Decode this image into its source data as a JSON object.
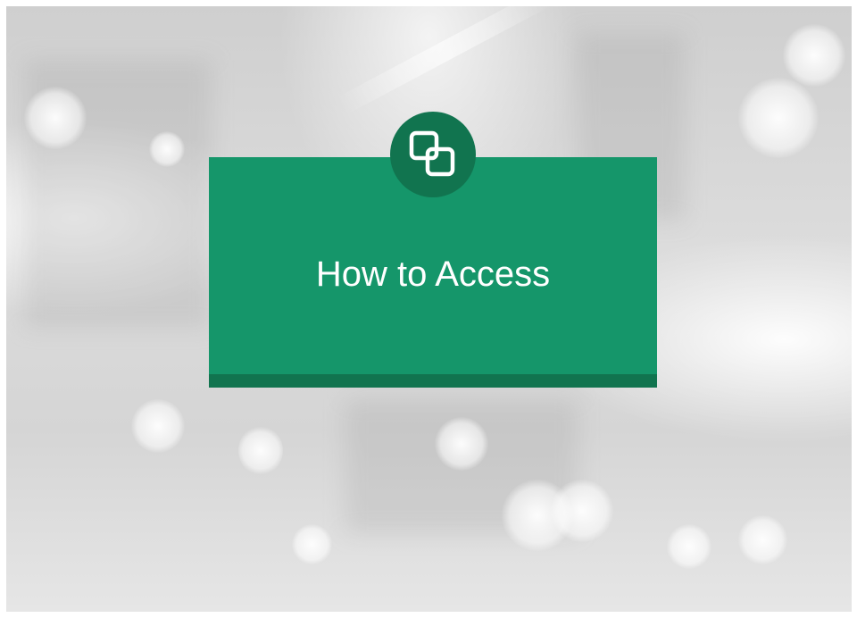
{
  "slide": {
    "title": "How to Access",
    "icon": "copy-windows-icon"
  },
  "colors": {
    "card_green": "#15966a",
    "card_dark_green": "#11744f",
    "text": "#ffffff",
    "background": "#d8d8d8"
  }
}
